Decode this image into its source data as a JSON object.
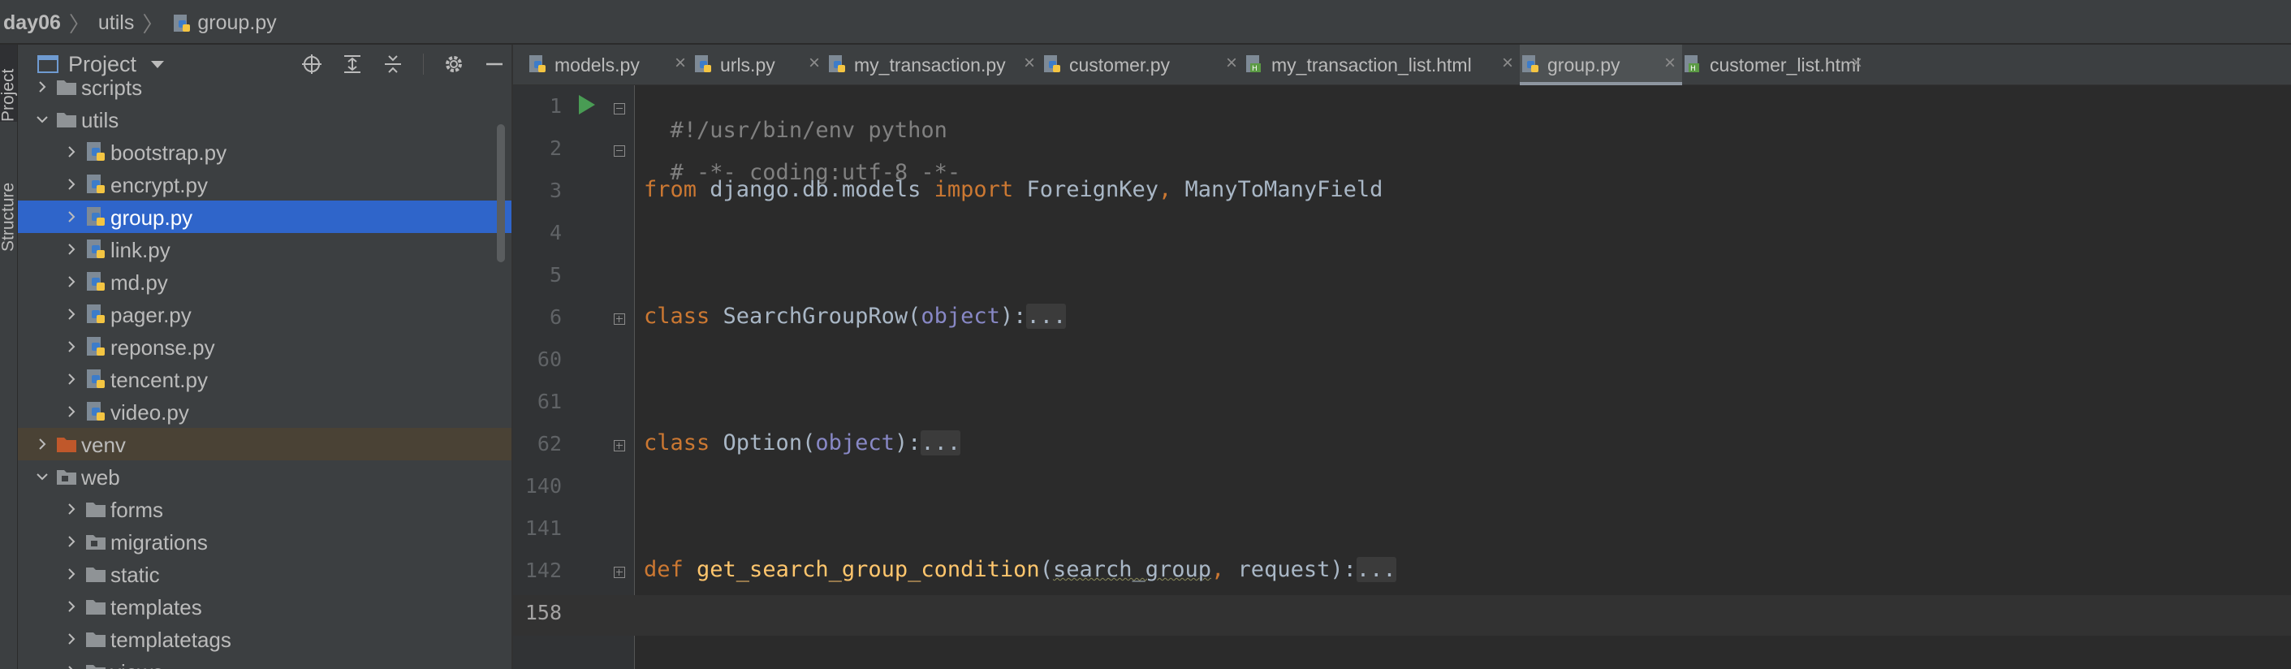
{
  "breadcrumb": {
    "project": "day06",
    "folder": "utils",
    "file": "group.py"
  },
  "left_strip": {
    "project_tab": "Project",
    "structure_tab": "Structure"
  },
  "panel": {
    "title": "Project",
    "tree": [
      {
        "label": "scripts",
        "type": "folder",
        "depth": 1,
        "expanded": false
      },
      {
        "label": "utils",
        "type": "folder",
        "depth": 1,
        "expanded": true
      },
      {
        "label": "bootstrap.py",
        "type": "python",
        "depth": 2
      },
      {
        "label": "encrypt.py",
        "type": "python",
        "depth": 2
      },
      {
        "label": "group.py",
        "type": "python",
        "depth": 2,
        "selected": true
      },
      {
        "label": "link.py",
        "type": "python",
        "depth": 2
      },
      {
        "label": "md.py",
        "type": "python",
        "depth": 2
      },
      {
        "label": "pager.py",
        "type": "python",
        "depth": 2
      },
      {
        "label": "reponse.py",
        "type": "python",
        "depth": 2
      },
      {
        "label": "tencent.py",
        "type": "python",
        "depth": 2
      },
      {
        "label": "video.py",
        "type": "python",
        "depth": 2
      },
      {
        "label": "venv",
        "type": "folder-excluded",
        "depth": 1,
        "expanded": false
      },
      {
        "label": "web",
        "type": "folder-module",
        "depth": 1,
        "expanded": true
      },
      {
        "label": "forms",
        "type": "folder",
        "depth": 2,
        "expanded": false
      },
      {
        "label": "migrations",
        "type": "folder-module",
        "depth": 2,
        "expanded": false
      },
      {
        "label": "static",
        "type": "folder",
        "depth": 2,
        "expanded": false
      },
      {
        "label": "templates",
        "type": "folder",
        "depth": 2,
        "expanded": false
      },
      {
        "label": "templatetags",
        "type": "folder",
        "depth": 2,
        "expanded": false
      },
      {
        "label": "views",
        "type": "folder",
        "depth": 2,
        "expanded": false
      }
    ]
  },
  "tabs": [
    {
      "label": "models.py",
      "type": "python"
    },
    {
      "label": "urls.py",
      "type": "python"
    },
    {
      "label": "my_transaction.py",
      "type": "python"
    },
    {
      "label": "customer.py",
      "type": "python"
    },
    {
      "label": "my_transaction_list.html",
      "type": "html"
    },
    {
      "label": "group.py",
      "type": "python",
      "active": true
    },
    {
      "label": "customer_list.html",
      "type": "html"
    }
  ],
  "editor": {
    "line_numbers": [
      "1",
      "2",
      "3",
      "4",
      "5",
      "6",
      "60",
      "61",
      "62",
      "140",
      "141",
      "142",
      "158"
    ],
    "current_line": "158",
    "lines": {
      "l1": "#!/usr/bin/env python",
      "l2": "# -*- coding:utf-8 -*-",
      "l3_kw1": "from",
      "l3_mod": " django.db.models ",
      "l3_kw2": "import",
      "l3_names": " ForeignKey",
      "l3_comma": ",",
      "l3_name2": " ManyToManyField",
      "l6_kw": "class",
      "l6_name": " SearchGroupRow(",
      "l6_base": "object",
      "l6_close": "):",
      "l6_fold": "...",
      "l62_kw": "class",
      "l62_name": " Option(",
      "l62_base": "object",
      "l62_close": "):",
      "l62_fold": "...",
      "l142_kw": "def",
      "l142_fn": " get_search_group_condition",
      "l142_open": "(",
      "l142_p1": "search_group",
      "l142_comma": ",",
      "l142_p2": " request",
      "l142_close": "):",
      "l142_fold": "..."
    }
  },
  "colors": {
    "keyword": "#cc7832",
    "comment": "#808080",
    "function": "#ffc66d",
    "builtin": "#8888c6",
    "text": "#a9b7c6",
    "selection": "#2f65ca"
  }
}
